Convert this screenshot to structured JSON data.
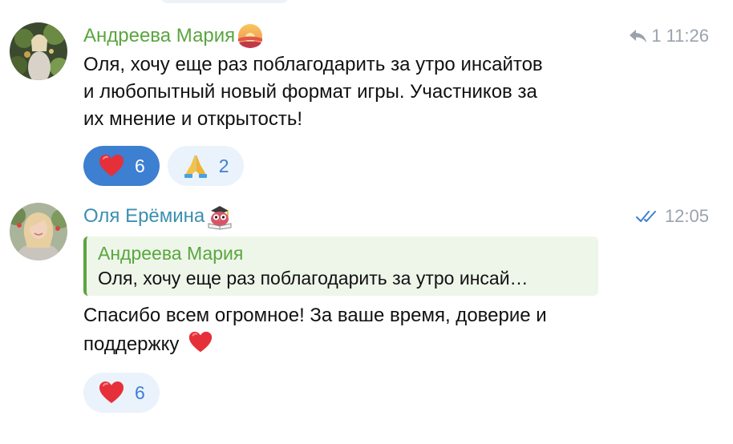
{
  "messages": [
    {
      "author": "Андреева Мария",
      "author_color": "#5aa63f",
      "status_icon": "sunset-emoji",
      "reply_count": "1",
      "time": "11:26",
      "text_lines": [
        "Оля, хочу еще раз поблагодарить за утро инсайтов",
        "и любопытный новый формат игры. Участников за",
        "их мнение и открытость!"
      ],
      "reactions": [
        {
          "emoji": "red-heart-emoji",
          "count": "6",
          "active": true
        },
        {
          "emoji": "folded-hands-emoji",
          "count": "2",
          "active": false
        }
      ]
    },
    {
      "author": "Оля Ерёмина",
      "author_color": "#3d8fb0",
      "status_icon": "owl-reading-emoji",
      "read_status": "double-check-icon",
      "time": "12:05",
      "quote": {
        "author": "Андреева Мария",
        "text": "Оля, хочу еще раз поблагодарить за утро инсай…"
      },
      "text_lines": [
        "Спасибо всем огромное! За ваше время, доверие и",
        "поддержку"
      ],
      "reactions": [
        {
          "emoji": "red-heart-emoji",
          "count": "6",
          "active": false
        }
      ]
    }
  ],
  "colors": {
    "accent": "#3d7fd1",
    "meta": "#9aa3ad",
    "quote_bg": "#eef6ea"
  }
}
